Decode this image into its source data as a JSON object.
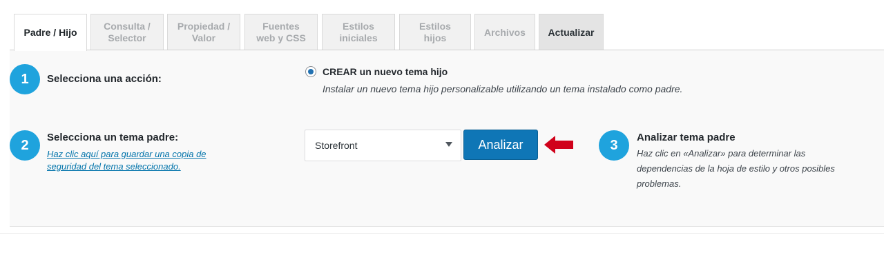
{
  "tabs": [
    {
      "label": "Padre / Hijo",
      "state": "active"
    },
    {
      "label": "Consulta /\nSelector",
      "state": "inactive"
    },
    {
      "label": "Propiedad /\nValor",
      "state": "inactive"
    },
    {
      "label": "Fuentes\nweb y CSS",
      "state": "inactive"
    },
    {
      "label": "Estilos\niniciales",
      "state": "inactive"
    },
    {
      "label": "Estilos\nhijos",
      "state": "inactive"
    },
    {
      "label": "Archivos",
      "state": "inactive"
    },
    {
      "label": "Actualizar",
      "state": "highlighted"
    }
  ],
  "step1": {
    "number": "1",
    "label": "Selecciona una acción:",
    "option_label": "CREAR un nuevo tema hijo",
    "option_desc": "Instalar un nuevo tema hijo personalizable utilizando un tema instalado como padre.",
    "option_selected": true
  },
  "step2": {
    "number": "2",
    "label": "Selecciona un tema padre:",
    "link": "Haz clic aquí para guardar una copia de seguridad del tema seleccionado.",
    "select_value": "Storefront",
    "button_label": "Analizar"
  },
  "step3": {
    "number": "3",
    "title": "Analizar tema padre",
    "desc": "Haz clic en «Analizar» para determinar las dependencias de la hoja de estilo y otros posibles problemas."
  },
  "colors": {
    "accent": "#1fa3dd",
    "button": "#0f76b6",
    "arrow": "#d0021b",
    "link": "#0073aa"
  },
  "icons": {
    "arrow": "arrow-left-icon",
    "caret": "chevron-down-icon"
  }
}
